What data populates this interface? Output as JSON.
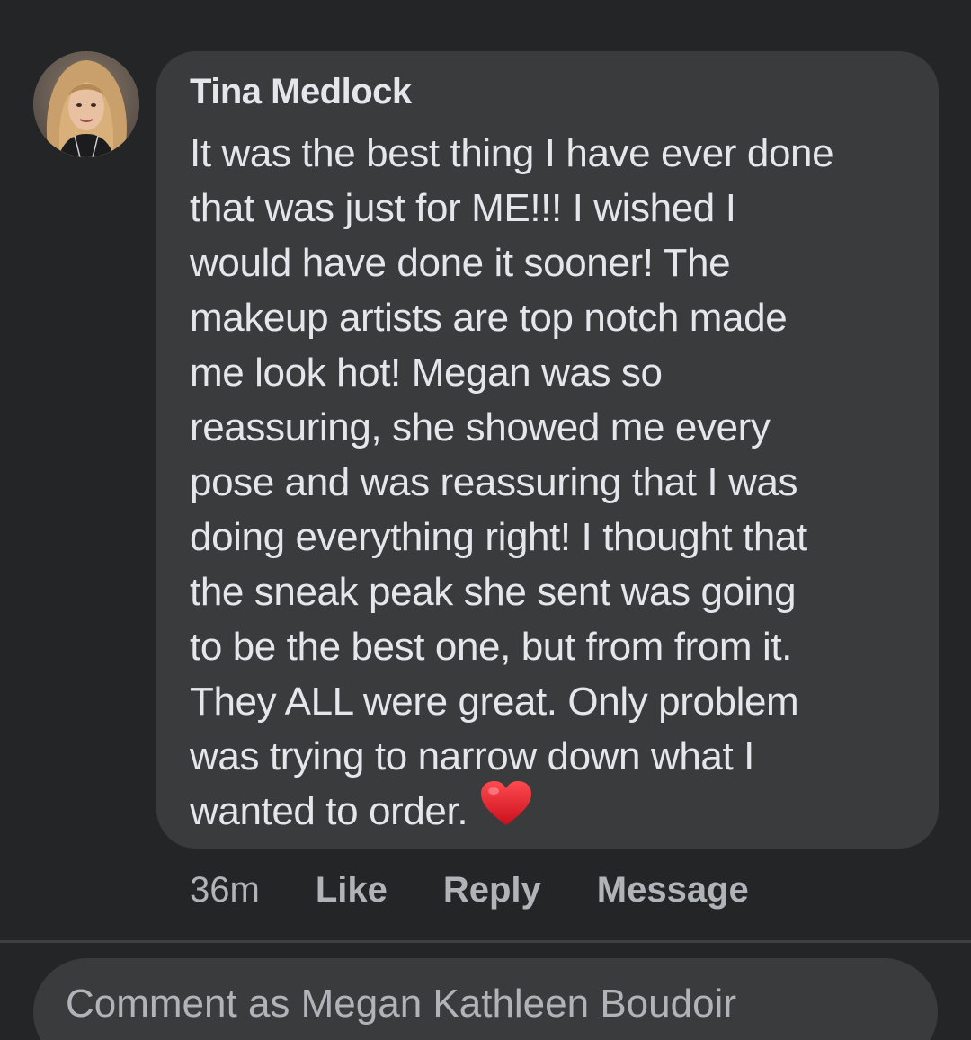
{
  "comment": {
    "author": "Tina Medlock",
    "lines": [
      "It was the best thing I have ever done",
      "that was just for ME!!! I wished I",
      "would have done it sooner! The",
      "makeup artists are top notch made",
      "me look hot! Megan was so",
      "reassuring, she showed me every",
      "pose and was reassuring that I was",
      "doing everything right! I thought that",
      "the sneak peak she sent was going",
      "to be the best one, but from from it.",
      "They ALL were great. Only problem",
      "was trying to narrow down what  I",
      "wanted to order."
    ],
    "emoji": "red-heart-icon"
  },
  "actions": {
    "timestamp": "36m",
    "like": "Like",
    "reply": "Reply",
    "message": "Message"
  },
  "composer": {
    "placeholder": "Comment as Megan Kathleen Boudoir"
  },
  "colors": {
    "background": "#242526",
    "bubble": "#3a3b3c",
    "text": "#e4e6eb",
    "secondary_text": "#b0b3b8",
    "heart": "#e0202e"
  }
}
